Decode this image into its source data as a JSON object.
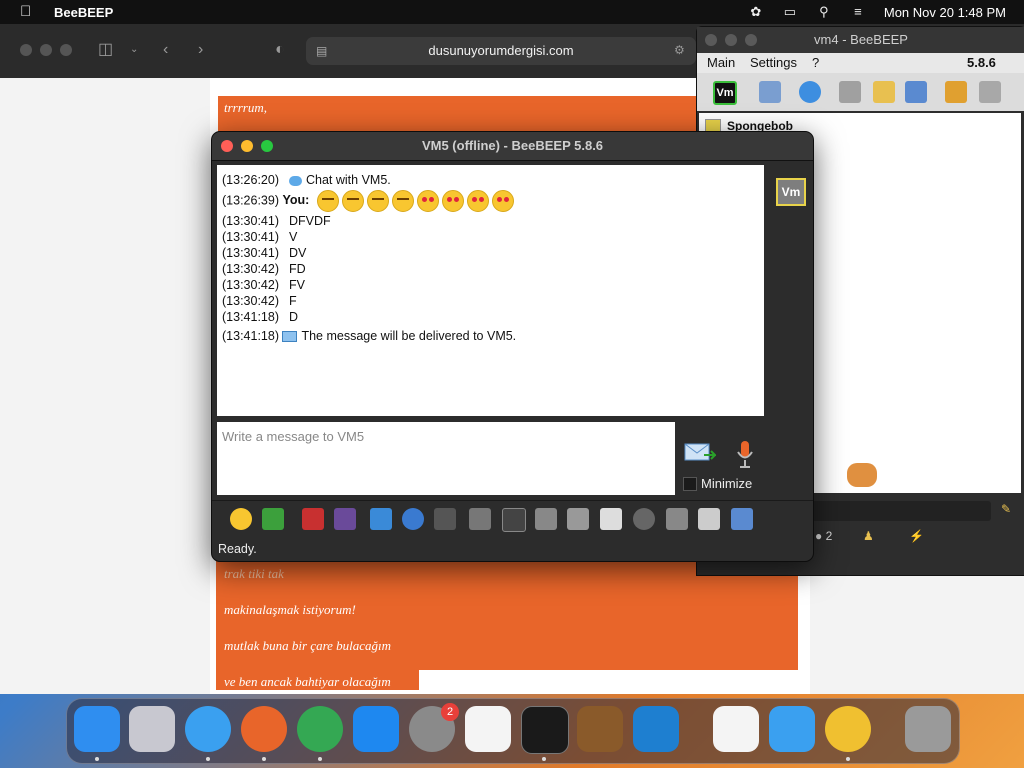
{
  "menubar": {
    "app_name": "BeeBEEP",
    "datetime": "Mon Nov 20  1:48 PM"
  },
  "browser": {
    "url": "dusunuyorumdergisi.com",
    "poem_top": "trrrrum,",
    "poem_lines": [
      "trak tiki tak",
      "makinalaşmak istiyorum!",
      "mutlak buna bir çare bulacağım",
      "ve ben ancak bahtiyar olacağım"
    ]
  },
  "vm4": {
    "title": "vm4 - BeeBEEP",
    "menu_main": "Main",
    "menu_settings": "Settings",
    "menu_help": "?",
    "version": "5.8.6",
    "user_item": "Spongebob",
    "status_count": "2"
  },
  "chat": {
    "title": "VM5 (offline) - BeeBEEP 5.8.6",
    "header_ts": "(13:26:20)",
    "header_text": "Chat with VM5.",
    "you_ts": "(13:26:39)",
    "you_label": "You:",
    "messages": [
      {
        "ts": "(13:30:41)",
        "text": "DFVDF"
      },
      {
        "ts": "(13:30:41)",
        "text": "V"
      },
      {
        "ts": "(13:30:41)",
        "text": "DV"
      },
      {
        "ts": "(13:30:42)",
        "text": "FD"
      },
      {
        "ts": "(13:30:42)",
        "text": "FV"
      },
      {
        "ts": "(13:30:42)",
        "text": "F"
      },
      {
        "ts": "(13:41:18)",
        "text": "D"
      }
    ],
    "delivery_ts": "(13:41:18)",
    "delivery_text": "The message will be delivered to VM5.",
    "badge": "Vm",
    "input_placeholder": "Write a message to VM5",
    "minimize_label": "Minimize",
    "status": "Ready."
  },
  "dock": {
    "settings_badge": "2"
  },
  "colors": {
    "orange": "#e8652a",
    "accent_yellow": "#e8d34a"
  }
}
